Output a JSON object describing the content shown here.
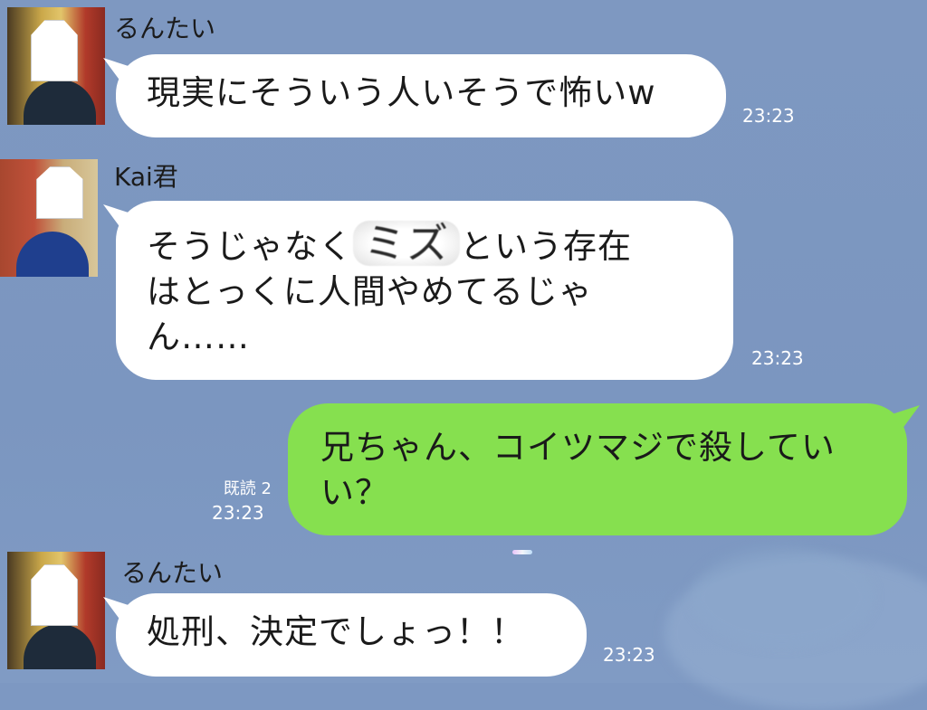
{
  "messages": [
    {
      "sender": "るんたい",
      "text": "現実にそういう人いそうで怖いw",
      "time": "23:23"
    },
    {
      "sender": "Kai君",
      "text_before": "そうじゃなく",
      "text_blurred": "ミズ",
      "text_after": "という存在\nはとっくに人間やめてるじゃ\nん……",
      "time": "23:23"
    },
    {
      "sender": "me",
      "text": "兄ちゃん、コイツマジで殺してい\nい？",
      "read_status": "既読 2",
      "time": "23:23"
    },
    {
      "sender": "るんたい",
      "text": "処刑、決定でしょっ！！",
      "time": "23:23"
    }
  ],
  "colors": {
    "background": "#7d98c2",
    "incoming_bubble": "#ffffff",
    "outgoing_bubble": "#86e04f"
  }
}
